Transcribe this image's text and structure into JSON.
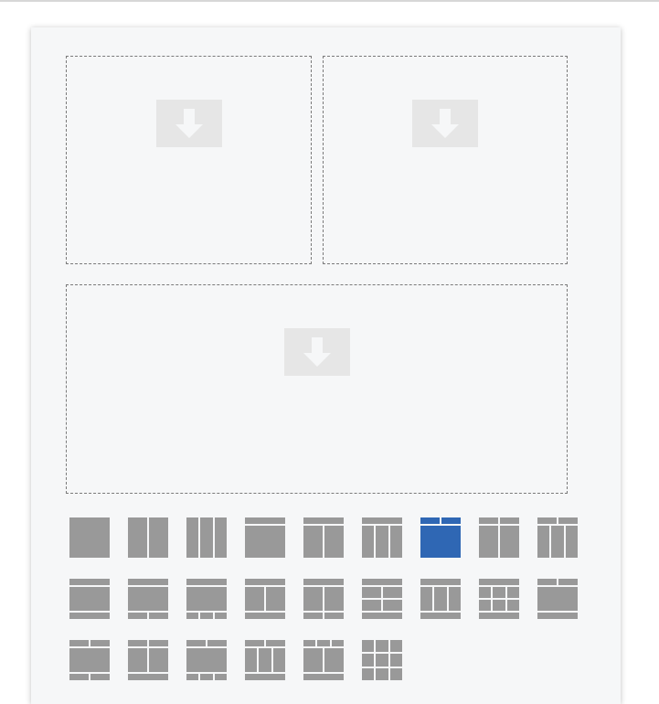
{
  "colors": {
    "tile": "#999999",
    "tile_selected": "#2f67b4",
    "separator": "#f6f7f8",
    "panel": "#f6f7f8",
    "drop_icon": "#e6e6e6"
  },
  "drop_zones": [
    {
      "icon": "download-arrow-icon"
    },
    {
      "icon": "download-arrow-icon"
    },
    {
      "icon": "download-arrow-icon"
    }
  ],
  "layouts": [
    {
      "id": "single"
    },
    {
      "id": "two-columns"
    },
    {
      "id": "three-columns"
    },
    {
      "id": "header-one"
    },
    {
      "id": "header-two-columns"
    },
    {
      "id": "header-three-columns"
    },
    {
      "id": "header-two-top-one-bottom",
      "selected": true
    },
    {
      "id": "strip-two-columns"
    },
    {
      "id": "strip-three-columns"
    },
    {
      "id": "header-body-footer"
    },
    {
      "id": "header-body-footer-two"
    },
    {
      "id": "header-body-footer-three"
    },
    {
      "id": "header-split-body-footer"
    },
    {
      "id": "header-two-body-footer"
    },
    {
      "id": "header-quad-footer"
    },
    {
      "id": "header-three-body-footer"
    },
    {
      "id": "header-six-footer"
    },
    {
      "id": "strip-header-body-footer"
    },
    {
      "id": "strip-body-footer-two"
    },
    {
      "id": "strip-two-body-footer"
    },
    {
      "id": "strip-two-footer-three"
    },
    {
      "id": "strip-three-footer-three"
    },
    {
      "id": "strip-quad-footer"
    },
    {
      "id": "nine-grid"
    }
  ]
}
